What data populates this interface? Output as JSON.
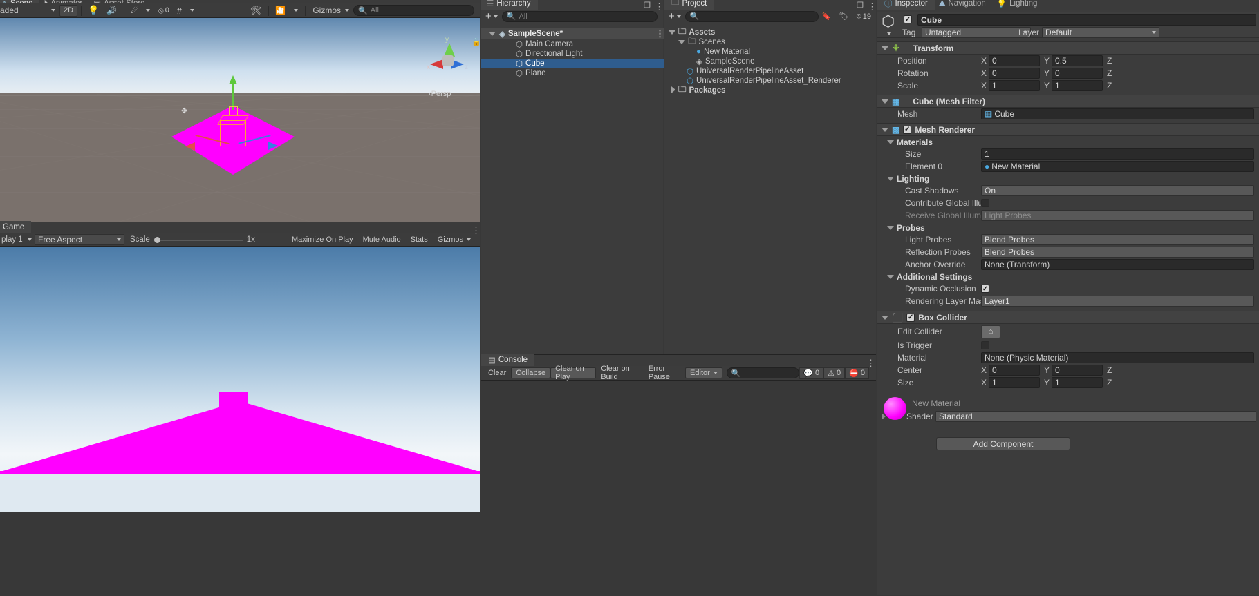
{
  "scene_view": {
    "tabs": [
      {
        "label": "Scene",
        "icon": "scene-icon",
        "active": true
      },
      {
        "label": "Animator",
        "icon": "animator-icon",
        "active": false
      },
      {
        "label": "Asset Store",
        "icon": "asset-store-icon",
        "active": false
      }
    ],
    "shading_mode": "aded",
    "mode_2d": "2D",
    "gizmo_count": "0",
    "gizmos_label": "Gizmos",
    "search_placeholder": "All",
    "persp_label": "Persp",
    "axis_x": "x",
    "axis_y": "y",
    "axis_z": "z"
  },
  "game_view": {
    "tab_label": "Game",
    "display": "play 1",
    "aspect": "Free Aspect",
    "scale_label": "Scale",
    "scale_value": "1x",
    "maximize_on_play": "Maximize On Play",
    "mute_audio": "Mute Audio",
    "stats": "Stats",
    "gizmos": "Gizmos"
  },
  "hierarchy": {
    "tab_label": "Hierarchy",
    "add_label": "+",
    "search_placeholder": "All",
    "items": [
      {
        "label": "SampleScene*",
        "icon": "scene-icon",
        "depth": 0,
        "selected": false,
        "is_scene": true
      },
      {
        "label": "Main Camera",
        "icon": "gameobject-icon",
        "depth": 1,
        "selected": false
      },
      {
        "label": "Directional Light",
        "icon": "gameobject-icon",
        "depth": 1,
        "selected": false
      },
      {
        "label": "Cube",
        "icon": "gameobject-icon",
        "depth": 1,
        "selected": true
      },
      {
        "label": "Plane",
        "icon": "gameobject-icon",
        "depth": 1,
        "selected": false
      }
    ]
  },
  "project": {
    "tab_label": "Project",
    "add_label": "+",
    "hidden_count": "19",
    "items": [
      {
        "label": "Assets",
        "icon": "folder-icon",
        "depth": 0,
        "expanded": true,
        "bold": true
      },
      {
        "label": "Scenes",
        "icon": "folder-icon",
        "depth": 1,
        "expanded": true,
        "bold": false
      },
      {
        "label": "New Material",
        "icon": "material-icon",
        "depth": 2,
        "expanded": null,
        "bold": false
      },
      {
        "label": "SampleScene",
        "icon": "scene-icon",
        "depth": 2,
        "expanded": null,
        "bold": false
      },
      {
        "label": "UniversalRenderPipelineAsset",
        "icon": "asset-icon",
        "depth": 1,
        "expanded": null,
        "bold": false
      },
      {
        "label": "UniversalRenderPipelineAsset_Renderer",
        "icon": "asset-icon",
        "depth": 1,
        "expanded": null,
        "bold": false
      },
      {
        "label": "Packages",
        "icon": "folder-icon",
        "depth": 0,
        "expanded": false,
        "bold": true
      }
    ]
  },
  "console": {
    "tab_label": "Console",
    "buttons": {
      "clear": "Clear",
      "collapse": "Collapse",
      "clear_on_play": "Clear on Play",
      "clear_on_build": "Clear on Build",
      "error_pause": "Error Pause",
      "editor": "Editor"
    },
    "counts": {
      "log": "0",
      "warning": "0",
      "error": "0"
    }
  },
  "inspector": {
    "tabs": [
      {
        "label": "Inspector",
        "icon": "inspector-icon",
        "active": true
      },
      {
        "label": "Navigation",
        "icon": "navigation-icon",
        "active": false
      },
      {
        "label": "Lighting",
        "icon": "lighting-icon",
        "active": false
      }
    ],
    "object": {
      "enabled": true,
      "name": "Cube",
      "tag_label": "Tag",
      "tag_value": "Untagged",
      "layer_label": "Layer",
      "layer_value": "Default"
    },
    "transform": {
      "title": "Transform",
      "rows": [
        {
          "label": "Position",
          "x": "0",
          "y": "0.5",
          "z": ""
        },
        {
          "label": "Rotation",
          "x": "0",
          "y": "0",
          "z": ""
        },
        {
          "label": "Scale",
          "x": "1",
          "y": "1",
          "z": ""
        }
      ]
    },
    "mesh_filter": {
      "title": "Cube (Mesh Filter)",
      "mesh_label": "Mesh",
      "mesh_value": "Cube"
    },
    "mesh_renderer": {
      "title": "Mesh Renderer",
      "enabled": true,
      "materials_title": "Materials",
      "size_label": "Size",
      "size_value": "1",
      "element0_label": "Element 0",
      "element0_value": "New Material",
      "lighting_title": "Lighting",
      "cast_shadows_label": "Cast Shadows",
      "cast_shadows_value": "On",
      "contribute_gi_label": "Contribute Global Illumin",
      "contribute_gi_checked": false,
      "receive_gi_label": "Receive Global Illuminat",
      "receive_gi_value": "Light Probes",
      "probes_title": "Probes",
      "light_probes_label": "Light Probes",
      "light_probes_value": "Blend Probes",
      "reflection_probes_label": "Reflection Probes",
      "reflection_probes_value": "Blend Probes",
      "anchor_override_label": "Anchor Override",
      "anchor_override_value": "None (Transform)",
      "additional_title": "Additional Settings",
      "dynamic_occlusion_label": "Dynamic Occlusion",
      "dynamic_occlusion_checked": true,
      "rendering_layer_label": "Rendering Layer Mask",
      "rendering_layer_value": "Layer1"
    },
    "box_collider": {
      "title": "Box Collider",
      "enabled": true,
      "edit_collider_label": "Edit Collider",
      "is_trigger_label": "Is Trigger",
      "is_trigger_checked": false,
      "material_label": "Material",
      "material_value": "None (Physic Material)",
      "center_label": "Center",
      "center_x": "0",
      "center_y": "0",
      "size_label": "Size",
      "size_x": "1",
      "size_y": "1"
    },
    "material_preview": {
      "name": "New Material",
      "shader_label": "Shader",
      "shader_value": "Standard",
      "swatch_color": "#ff00ff"
    },
    "add_component_label": "Add Component"
  },
  "colors": {
    "magenta": "#ff00ff",
    "selection_blue": "#2f5d8e",
    "panel_bg": "#3c3c3c"
  }
}
